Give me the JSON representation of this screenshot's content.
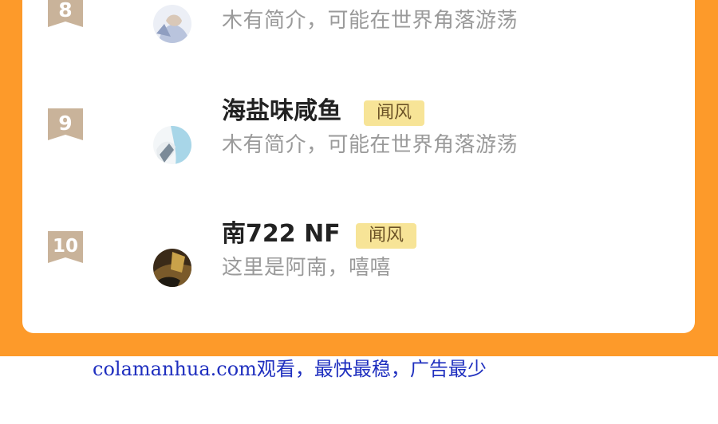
{
  "rankings": [
    {
      "rank": "8",
      "name": "",
      "tag": "",
      "bio": "木有简介，可能在世界角落游荡"
    },
    {
      "rank": "9",
      "name": "海盐味咸鱼",
      "tag": "闻风",
      "bio": "木有简介，可能在世界角落游荡"
    },
    {
      "rank": "10",
      "name": "南722 NF",
      "tag": "闻风",
      "bio": "这里是阿南，嘻嘻"
    }
  ],
  "footer": {
    "text": "colamanhua.com观看，最快最稳，广告最少"
  },
  "colors": {
    "frame": "#fd9a2a",
    "badge": "#c9b39a",
    "tag_bg": "#f7e497",
    "footer_link": "#1f2fbf"
  },
  "icons": [
    "rank-ribbon-icon",
    "user-avatar"
  ]
}
